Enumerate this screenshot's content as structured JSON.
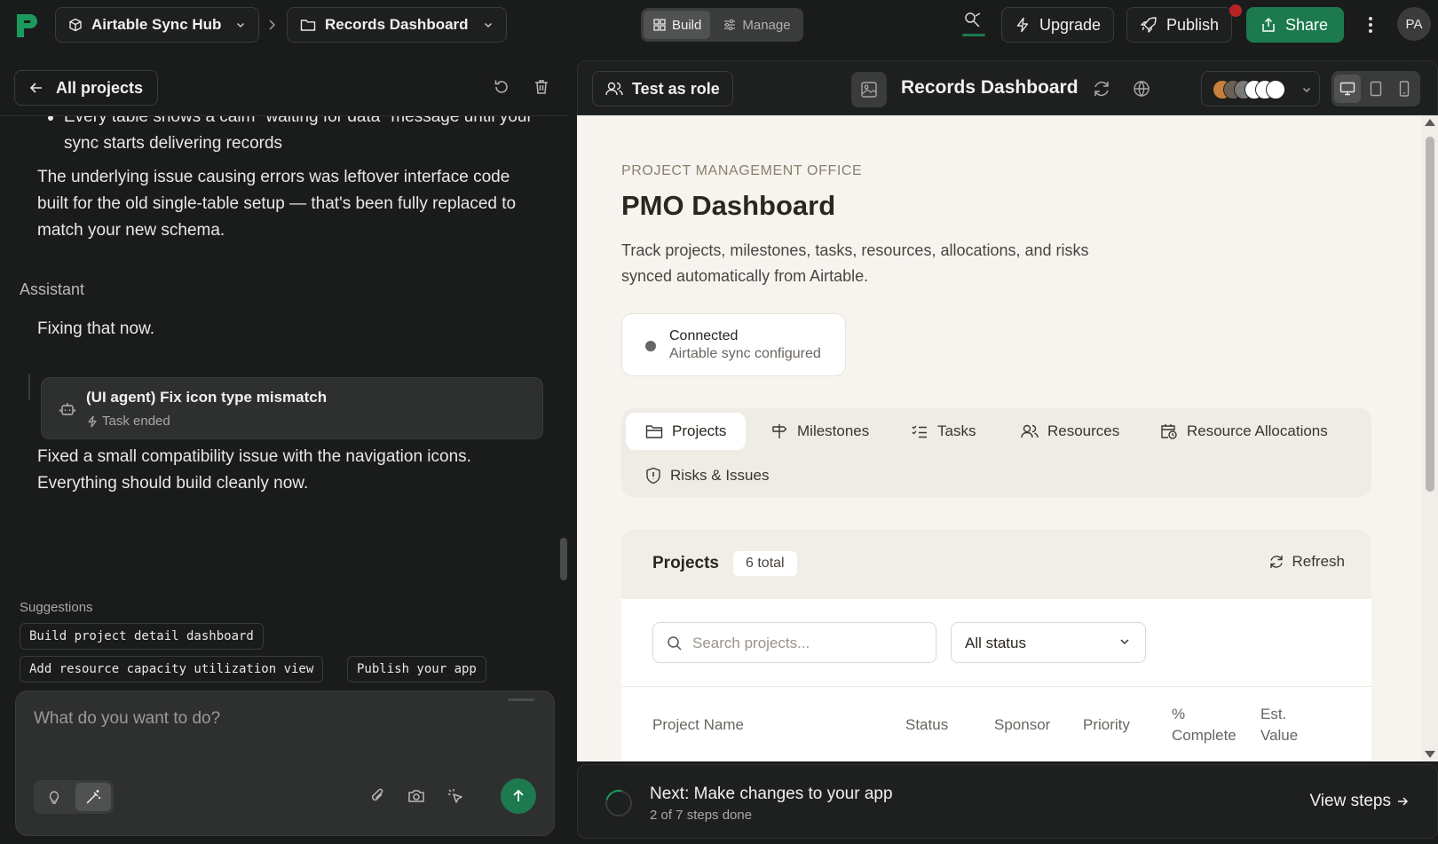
{
  "topbar": {
    "project_name": "Airtable Sync Hub",
    "page_name": "Records Dashboard",
    "mode_build": "Build",
    "mode_manage": "Manage",
    "upgrade_label": "Upgrade",
    "publish_label": "Publish",
    "share_label": "Share",
    "avatar_initials": "PA"
  },
  "left_panel": {
    "back_label": "All projects",
    "bullet_text": "Every table shows a calm \"waiting for data\" message until your sync starts delivering records",
    "explain_text": "The underlying issue causing errors was leftover interface code built for the old single-table setup — that's been fully replaced to match your new schema.",
    "assistant_label": "Assistant",
    "assistant_msg": "Fixing that now.",
    "task": {
      "title": "(UI agent) Fix icon type mismatch",
      "status": "Task ended"
    },
    "result_msg": "Fixed a small compatibility issue with the navigation icons. Everything should build cleanly now.",
    "suggestions_label": "Suggestions",
    "suggestions": [
      "Build project detail dashboard",
      "Add resource capacity utilization view",
      "Publish your app"
    ],
    "composer_placeholder": "What do you want to do?"
  },
  "right_panel": {
    "test_role_label": "Test as role",
    "title": "Records Dashboard",
    "swatches": [
      "#c87f3a",
      "#6b6055",
      "#7a7a78",
      "#ffffff",
      "#ffffff",
      "#ffffff"
    ]
  },
  "preview": {
    "eyebrow": "PROJECT MANAGEMENT OFFICE",
    "title": "PMO Dashboard",
    "description": "Track projects, milestones, tasks, resources, allocations, and risks synced automatically from Airtable.",
    "connection": {
      "status": "Connected",
      "detail": "Airtable sync configured"
    },
    "tabs": [
      {
        "label": "Projects",
        "icon": "folder-icon"
      },
      {
        "label": "Milestones",
        "icon": "signpost-icon"
      },
      {
        "label": "Tasks",
        "icon": "checklist-icon"
      },
      {
        "label": "Resources",
        "icon": "users-icon"
      },
      {
        "label": "Resource Allocations",
        "icon": "calendar-clock-icon"
      },
      {
        "label": "Risks & Issues",
        "icon": "shield-alert-icon"
      }
    ],
    "list": {
      "title": "Projects",
      "count_badge": "6 total",
      "refresh_label": "Refresh",
      "search_placeholder": "Search projects...",
      "status_filter": "All status",
      "columns": [
        "Project Name",
        "Status",
        "Sponsor",
        "Priority",
        "% Complete",
        "Est. Value"
      ]
    }
  },
  "next_bar": {
    "title": "Next: Make changes to your app",
    "progress": "2 of 7 steps done",
    "link_label": "View steps",
    "steps_done": 2,
    "steps_total": 7
  }
}
